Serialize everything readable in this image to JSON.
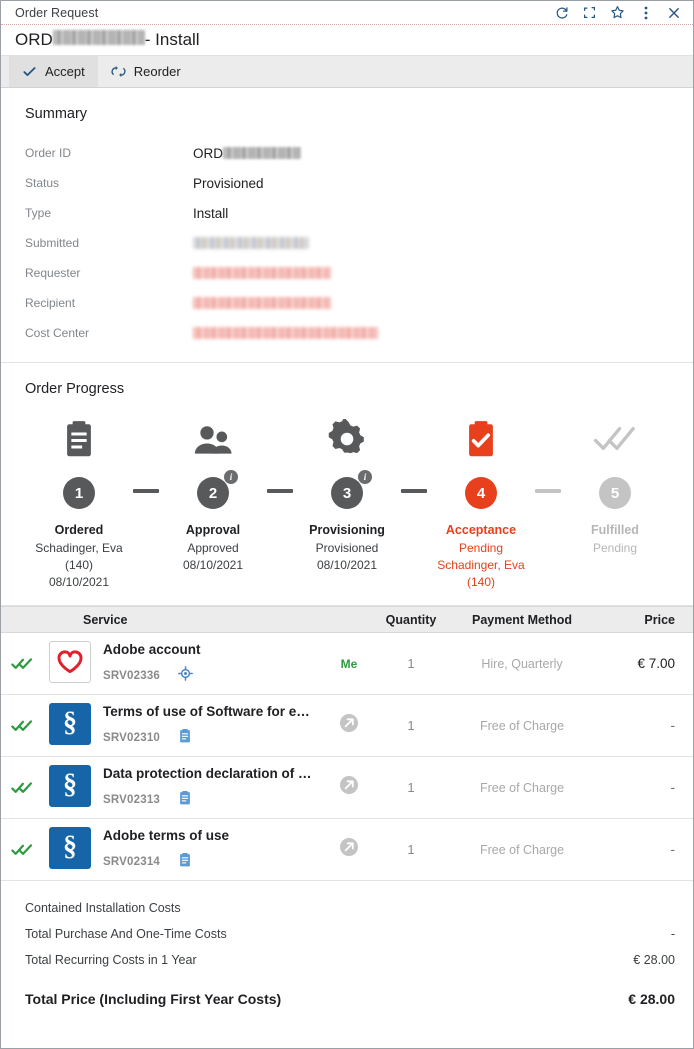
{
  "window": {
    "title": "Order Request",
    "icons": [
      {
        "name": "refresh-icon",
        "label": "Refresh"
      },
      {
        "name": "fullscreen-icon",
        "label": "Maximize"
      },
      {
        "name": "star-icon",
        "label": "Favorite"
      },
      {
        "name": "more-vertical-icon",
        "label": "More options"
      },
      {
        "name": "close-icon",
        "label": "Close"
      }
    ]
  },
  "header": {
    "title_prefix": "ORD",
    "title_redacted": true,
    "title_suffix": " - Install"
  },
  "toolbar": {
    "accept_label": "Accept",
    "reorder_label": "Reorder"
  },
  "summary": {
    "title": "Summary",
    "rows": [
      {
        "label": "Order ID",
        "value": "ORD",
        "redacted": "tail",
        "style": "dark"
      },
      {
        "label": "Status",
        "value": "Provisioned",
        "redacted": "none",
        "style": ""
      },
      {
        "label": "Type",
        "value": "Install",
        "redacted": "none",
        "style": ""
      },
      {
        "label": "Submitted",
        "value": "",
        "redacted": "full",
        "style": "mixed"
      },
      {
        "label": "Requester",
        "value": "",
        "redacted": "full",
        "style": "red"
      },
      {
        "label": "Recipient",
        "value": "",
        "redacted": "full",
        "style": "red"
      },
      {
        "label": "Cost Center",
        "value": "",
        "redacted": "full",
        "style": "red"
      }
    ]
  },
  "progress": {
    "title": "Order Progress",
    "steps": [
      {
        "number": "1",
        "icon": "clipboard-icon",
        "name": "Ordered",
        "lines": [
          "Schadinger, Eva",
          "(140)",
          "08/10/2021"
        ],
        "state": "done",
        "info_badge": false
      },
      {
        "number": "2",
        "icon": "people-icon",
        "name": "Approval",
        "lines": [
          "Approved",
          "08/10/2021"
        ],
        "state": "done",
        "info_badge": true
      },
      {
        "number": "3",
        "icon": "gear-icon",
        "name": "Provisioning",
        "lines": [
          "Provisioned",
          "08/10/2021"
        ],
        "state": "done",
        "info_badge": true
      },
      {
        "number": "4",
        "icon": "clipboard-check-icon",
        "name": "Acceptance",
        "lines": [
          "Pending",
          "Schadinger, Eva",
          "(140)"
        ],
        "state": "active",
        "info_badge": false
      },
      {
        "number": "5",
        "icon": "double-check-icon",
        "name": "Fulfilled",
        "lines": [
          "Pending"
        ],
        "state": "pending",
        "info_badge": false
      }
    ]
  },
  "services": {
    "columns": {
      "service": "Service",
      "quantity": "Quantity",
      "payment_method": "Payment Method",
      "price": "Price"
    },
    "rows": [
      {
        "logo": "adobe-creative-cloud-logo",
        "name": "Adobe account",
        "id": "SRV02336",
        "sub_icon": "target-icon",
        "action_icon": "none",
        "owner": "Me",
        "quantity": "1",
        "payment_method": "Hire, Quarterly",
        "price": "€ 7.00"
      },
      {
        "logo": "paragraph-logo",
        "name": "Terms of use of Software for e…",
        "id": "SRV02310",
        "sub_icon": "clipboard-small-icon",
        "action_icon": "arrow-circle-icon",
        "owner": "",
        "quantity": "1",
        "payment_method": "Free of Charge",
        "price": "-"
      },
      {
        "logo": "paragraph-logo",
        "name": "Data protection declaration of …",
        "id": "SRV02313",
        "sub_icon": "clipboard-small-icon",
        "action_icon": "arrow-circle-icon",
        "owner": "",
        "quantity": "1",
        "payment_method": "Free of Charge",
        "price": "-"
      },
      {
        "logo": "paragraph-logo",
        "name": "Adobe terms of use",
        "id": "SRV02314",
        "sub_icon": "clipboard-small-icon",
        "action_icon": "arrow-circle-icon",
        "owner": "",
        "quantity": "1",
        "payment_method": "Free of Charge",
        "price": "-"
      }
    ]
  },
  "totals": {
    "rows": [
      {
        "label": "Contained Installation Costs",
        "value": ""
      },
      {
        "label": "Total Purchase And One-Time Costs",
        "value": "-"
      },
      {
        "label": "Total Recurring Costs in 1 Year",
        "value": "€ 28.00"
      }
    ],
    "grand": {
      "label": "Total Price (Including First Year Costs)",
      "value": "€ 28.00"
    }
  },
  "colors": {
    "accent_orange": "#e8401c",
    "link_blue": "#27557f",
    "paragraph_blue": "#1565a8",
    "adobe_red": "#e0202a",
    "check_green": "#2e9b3f",
    "muted_gray": "#c4c4c4"
  }
}
